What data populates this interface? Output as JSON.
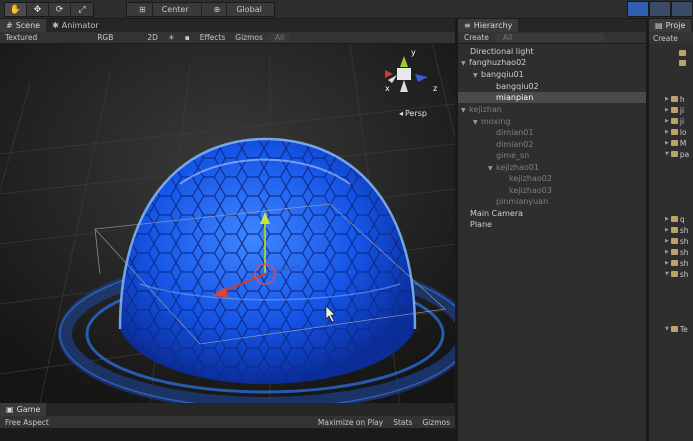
{
  "toolbar": {
    "pivot_center": "Center",
    "pivot_global": "Global"
  },
  "scene": {
    "tab_scene": "Scene",
    "tab_animator": "Animator",
    "render_mode": "Textured",
    "color_mode": "RGB",
    "mode_2d": "2D",
    "effects": "Effects",
    "gizmos": "Gizmos",
    "search_placeholder": "All",
    "persp_label": "Persp",
    "axis_x": "x",
    "axis_y": "y",
    "axis_z": "z"
  },
  "game": {
    "tab_game": "Game",
    "aspect": "Free Aspect",
    "maximize": "Maximize on Play",
    "stats": "Stats",
    "gizmos": "Gizmos"
  },
  "hierarchy": {
    "tab": "Hierarchy",
    "create": "Create",
    "search_placeholder": "All",
    "items": [
      {
        "label": "Directional light"
      },
      {
        "label": "fanghuzhao02"
      },
      {
        "label": "bangqiu01"
      },
      {
        "label": "bangqiu02"
      },
      {
        "label": "mianpian"
      },
      {
        "label": "kejizhan"
      },
      {
        "label": "moxing"
      },
      {
        "label": "dimian01"
      },
      {
        "label": "dimian02"
      },
      {
        "label": "gime_sn"
      },
      {
        "label": "kejizhao01"
      },
      {
        "label": "kejizhao02"
      },
      {
        "label": "kejizhao03"
      },
      {
        "label": "pinmianyuan"
      },
      {
        "label": "Main Camera"
      },
      {
        "label": "Plane"
      }
    ]
  },
  "project": {
    "tab": "Proje",
    "create": "Create",
    "items": [
      "h",
      "ji",
      "ji",
      "lo",
      "M",
      "pa",
      "q",
      "sh",
      "sh",
      "sh",
      "sh",
      "sh",
      "Te"
    ]
  },
  "colors": {
    "dome": "#1e6bff",
    "dome_light": "#7fb0ff",
    "axis_x": "#d23a2a",
    "axis_y": "#9acd32",
    "axis_z": "#2f5fd0",
    "selection": "#4a4a4a",
    "play_active": "#2f5fae"
  }
}
